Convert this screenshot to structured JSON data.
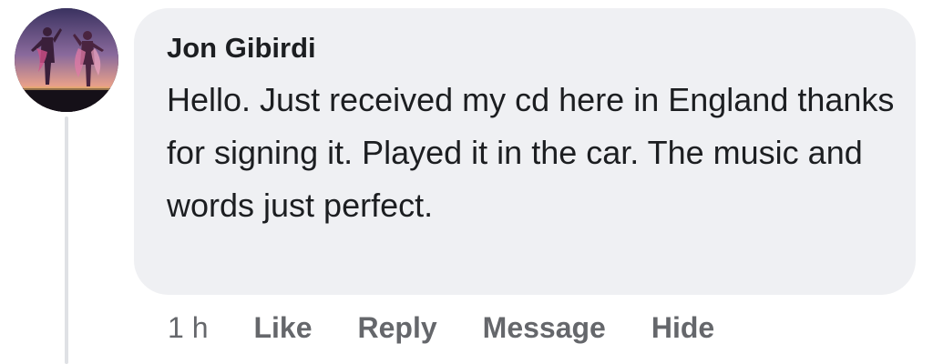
{
  "comment": {
    "author": "Jon Gibirdi",
    "text": "Hello. Just received my cd here in England thanks for signing it. Played it in the car. The music and words just perfect.",
    "avatar_icon": "profile-photo-concert-silhouettes",
    "colors": {
      "bubble_bg": "#eff0f3",
      "text": "#1c1e21",
      "action_text": "#65676b",
      "thread_line": "#dfe1e5"
    }
  },
  "actions": {
    "time": "1 h",
    "like": "Like",
    "reply": "Reply",
    "message": "Message",
    "hide": "Hide"
  }
}
